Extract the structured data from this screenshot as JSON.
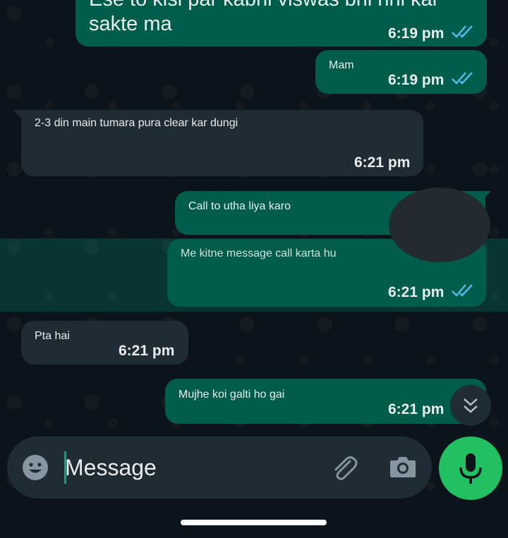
{
  "messages": [
    {
      "direction": "outgoing",
      "text_line1": "Ese to kisi par kabhi viswas bhi nhi kar",
      "text_line2": "sakte ma",
      "time": "6:19 pm",
      "status": "read"
    },
    {
      "direction": "outgoing",
      "text": "Mam",
      "time": "6:19 pm",
      "status": "read"
    },
    {
      "direction": "incoming",
      "text": "2-3 din main tumara pura clear kar dungi",
      "time": "6:21 pm"
    },
    {
      "direction": "outgoing",
      "text": "Call to utha liya karo",
      "time": "",
      "status": "read"
    },
    {
      "direction": "outgoing",
      "text": "Me kitne message call karta hu",
      "time": "6:21 pm",
      "status": "read",
      "selected": true
    },
    {
      "direction": "incoming",
      "text": "Pta hai",
      "time": "6:21 pm"
    },
    {
      "direction": "outgoing",
      "text": "Mujhe koi galti ho gai",
      "time": "6:21 pm",
      "status": "read"
    }
  ],
  "composer": {
    "placeholder": "Message",
    "icons": [
      "emoji-icon",
      "attach-icon",
      "camera-icon",
      "mic-icon"
    ]
  },
  "colors": {
    "background": "#0b141a",
    "outgoing_bubble": "#005c4b",
    "incoming_bubble": "#202c33",
    "read_ticks": "#53bdeb",
    "accent": "#21c063"
  }
}
